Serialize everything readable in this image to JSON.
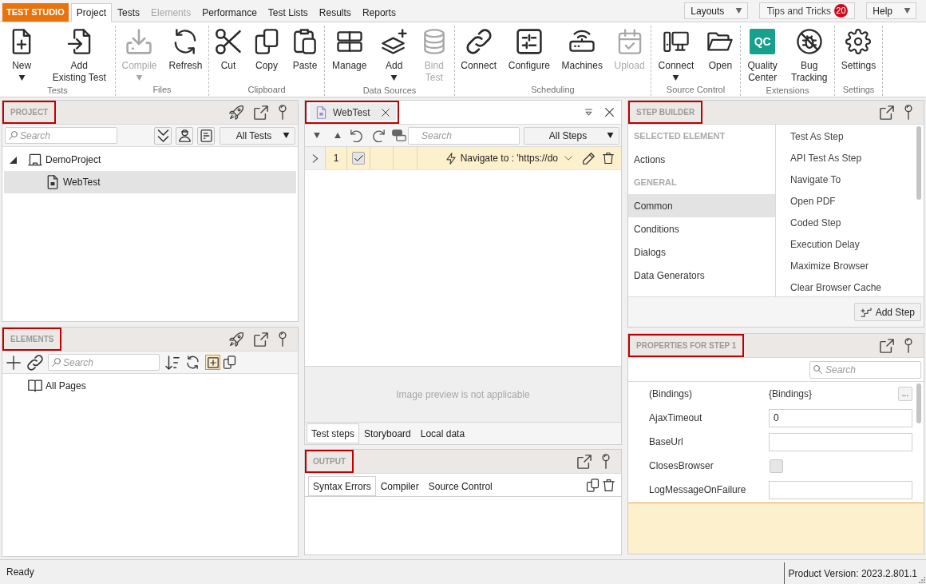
{
  "top_bar": {
    "app_name": "TEST STUDIO",
    "tabs": [
      {
        "label": "Project",
        "selected": true,
        "disabled": false
      },
      {
        "label": "Tests",
        "selected": false,
        "disabled": false
      },
      {
        "label": "Elements",
        "selected": false,
        "disabled": true
      },
      {
        "label": "Performance",
        "selected": false,
        "disabled": false
      },
      {
        "label": "Test Lists",
        "selected": false,
        "disabled": false
      },
      {
        "label": "Results",
        "selected": false,
        "disabled": false
      },
      {
        "label": "Reports",
        "selected": false,
        "disabled": false
      }
    ],
    "menus": [
      {
        "kind": "dropdown",
        "label": "Layouts"
      },
      {
        "kind": "counter",
        "label": "Tips and Tricks",
        "count": "20"
      },
      {
        "kind": "dropdown",
        "label": "Help"
      }
    ]
  },
  "ribbon": [
    {
      "label": "Tests",
      "buttons": [
        {
          "label": "New",
          "dropdown": true,
          "disabled": false
        },
        {
          "label": "Add\nExisting Test",
          "dropdown": false,
          "disabled": false
        }
      ]
    },
    {
      "label": "Files",
      "buttons": [
        {
          "label": "Compile",
          "dropdown": true,
          "disabled": true
        },
        {
          "label": "Refresh",
          "dropdown": false,
          "disabled": false
        }
      ]
    },
    {
      "label": "Clipboard",
      "buttons": [
        {
          "label": "Cut",
          "dropdown": false,
          "disabled": false
        },
        {
          "label": "Copy",
          "dropdown": false,
          "disabled": false
        },
        {
          "label": "Paste",
          "dropdown": false,
          "disabled": false
        }
      ]
    },
    {
      "label": "Data Sources",
      "buttons": [
        {
          "label": "Manage",
          "dropdown": false,
          "disabled": false
        },
        {
          "label": "Add",
          "dropdown": true,
          "disabled": false
        },
        {
          "label": "Bind\nTest",
          "dropdown": false,
          "disabled": true
        }
      ]
    },
    {
      "label": "Scheduling",
      "buttons": [
        {
          "label": "Connect",
          "dropdown": false,
          "disabled": false
        },
        {
          "label": "Configure",
          "dropdown": false,
          "disabled": false
        },
        {
          "label": "Machines",
          "dropdown": false,
          "disabled": false
        },
        {
          "label": "Upload",
          "dropdown": false,
          "disabled": true
        }
      ]
    },
    {
      "label": "Source Control",
      "buttons": [
        {
          "label": "Connect",
          "dropdown": true,
          "disabled": false
        },
        {
          "label": "Open",
          "dropdown": false,
          "disabled": false
        }
      ]
    },
    {
      "label": "Extensions",
      "buttons": [
        {
          "label": "Quality\nCenter",
          "logo_text": "QC",
          "dropdown": false,
          "disabled": false
        },
        {
          "label": "Bug\nTracking",
          "dropdown": false,
          "disabled": false
        }
      ]
    },
    {
      "label": "Settings",
      "buttons": [
        {
          "label": "Settings",
          "dropdown": false,
          "disabled": false
        }
      ]
    }
  ],
  "project_panel": {
    "title": "PROJECT",
    "highlighted": true,
    "search": {
      "placeholder": "Search"
    },
    "filter": "All Tests",
    "tree": [
      {
        "label": "DemoProject",
        "expanded": true,
        "selected": false,
        "children": [
          {
            "label": "WebTest",
            "selected": true
          }
        ]
      }
    ]
  },
  "elements_panel": {
    "title": "ELEMENTS",
    "highlighted": true,
    "search": {
      "placeholder": "Search"
    },
    "toggle": {
      "on": true
    },
    "tree": [
      {
        "label": "All Pages",
        "selected": false
      }
    ]
  },
  "test_panel": {
    "tab": {
      "label": "WebTest",
      "highlighted": true
    },
    "search": {
      "placeholder": "Search"
    },
    "filter": "All Steps",
    "steps": [
      {
        "number": "1",
        "checked": true,
        "selected": true,
        "description": "Navigate to : 'https://do"
      }
    ],
    "preview_message": "Image preview is not applicable",
    "tabs": [
      {
        "label": "Test steps",
        "selected": true
      },
      {
        "label": "Storyboard",
        "selected": false
      },
      {
        "label": "Local data",
        "selected": false
      }
    ]
  },
  "output_panel": {
    "title": "OUTPUT",
    "highlighted": true,
    "tabs": [
      {
        "label": "Syntax Errors",
        "selected": true
      },
      {
        "label": "Compiler",
        "selected": false
      },
      {
        "label": "Source Control",
        "selected": false
      }
    ]
  },
  "step_builder": {
    "title": "STEP BUILDER",
    "highlighted": true,
    "categories": [
      {
        "kind": "heading",
        "label": "SELECTED ELEMENT",
        "selected": false
      },
      {
        "kind": "item",
        "label": "Actions",
        "selected": false
      },
      {
        "kind": "heading",
        "label": "GENERAL",
        "selected": false
      },
      {
        "kind": "item",
        "label": "Common",
        "selected": true
      },
      {
        "kind": "item",
        "label": "Conditions",
        "selected": false
      },
      {
        "kind": "item",
        "label": "Dialogs",
        "selected": false
      },
      {
        "kind": "item",
        "label": "Data Generators",
        "selected": false
      }
    ],
    "steps": [
      "Test As Step",
      "API Test As Step",
      "Navigate To",
      "Open PDF",
      "Coded Step",
      "Execution Delay",
      "Maximize Browser",
      "Clear Browser Cache"
    ],
    "add_button": "Add Step"
  },
  "properties_panel": {
    "title": "PROPERTIES FOR STEP 1",
    "highlighted": true,
    "search": {
      "placeholder": "Search"
    },
    "rows": [
      {
        "kind": "binding",
        "name": "(Bindings)",
        "value": "{Bindings}",
        "button": "..."
      },
      {
        "kind": "text",
        "name": "AjaxTimeout",
        "value": "0"
      },
      {
        "kind": "text",
        "name": "BaseUrl"
      },
      {
        "kind": "checkbox",
        "name": "ClosesBrowser",
        "checked": false
      },
      {
        "kind": "text",
        "name": "LogMessageOnFailure"
      }
    ]
  },
  "status_bar": {
    "status": "Ready",
    "version": "Product Version: 2023.2.801.1"
  }
}
